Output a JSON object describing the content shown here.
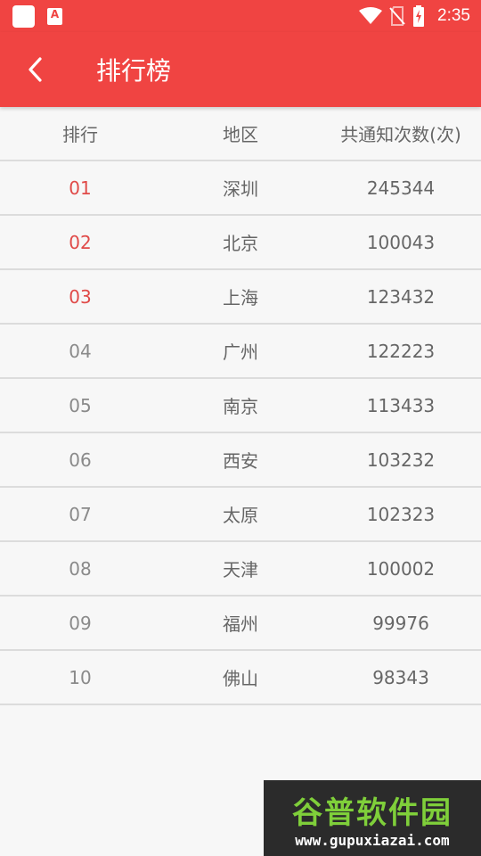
{
  "status_bar": {
    "time": "2:35",
    "icons": [
      "app-icon",
      "notification-a-icon",
      "wifi-icon",
      "no-sim-icon",
      "battery-charging-icon"
    ],
    "a_glyph": "A"
  },
  "app_bar": {
    "title": "排行榜",
    "back_icon": "chevron-left-icon"
  },
  "table": {
    "headers": [
      "排行",
      "地区",
      "共通知次数(次)"
    ],
    "rows": [
      {
        "rank": "01",
        "region": "深圳",
        "count": "245344"
      },
      {
        "rank": "02",
        "region": "北京",
        "count": "100043"
      },
      {
        "rank": "03",
        "region": "上海",
        "count": "123432"
      },
      {
        "rank": "04",
        "region": "广州",
        "count": "122223"
      },
      {
        "rank": "05",
        "region": "南京",
        "count": "113433"
      },
      {
        "rank": "06",
        "region": "西安",
        "count": "103232"
      },
      {
        "rank": "07",
        "region": "太原",
        "count": "102323"
      },
      {
        "rank": "08",
        "region": "天津",
        "count": "100002"
      },
      {
        "rank": "09",
        "region": "福州",
        "count": "99976"
      },
      {
        "rank": "10",
        "region": "佛山",
        "count": "98343"
      }
    ]
  },
  "watermark": {
    "title": "谷普软件园",
    "url": "www.gupuxiazai.com"
  },
  "colors": {
    "accent": "#f04442",
    "top_rank": "#e04a48",
    "normal_rank": "#8a8a8a"
  }
}
